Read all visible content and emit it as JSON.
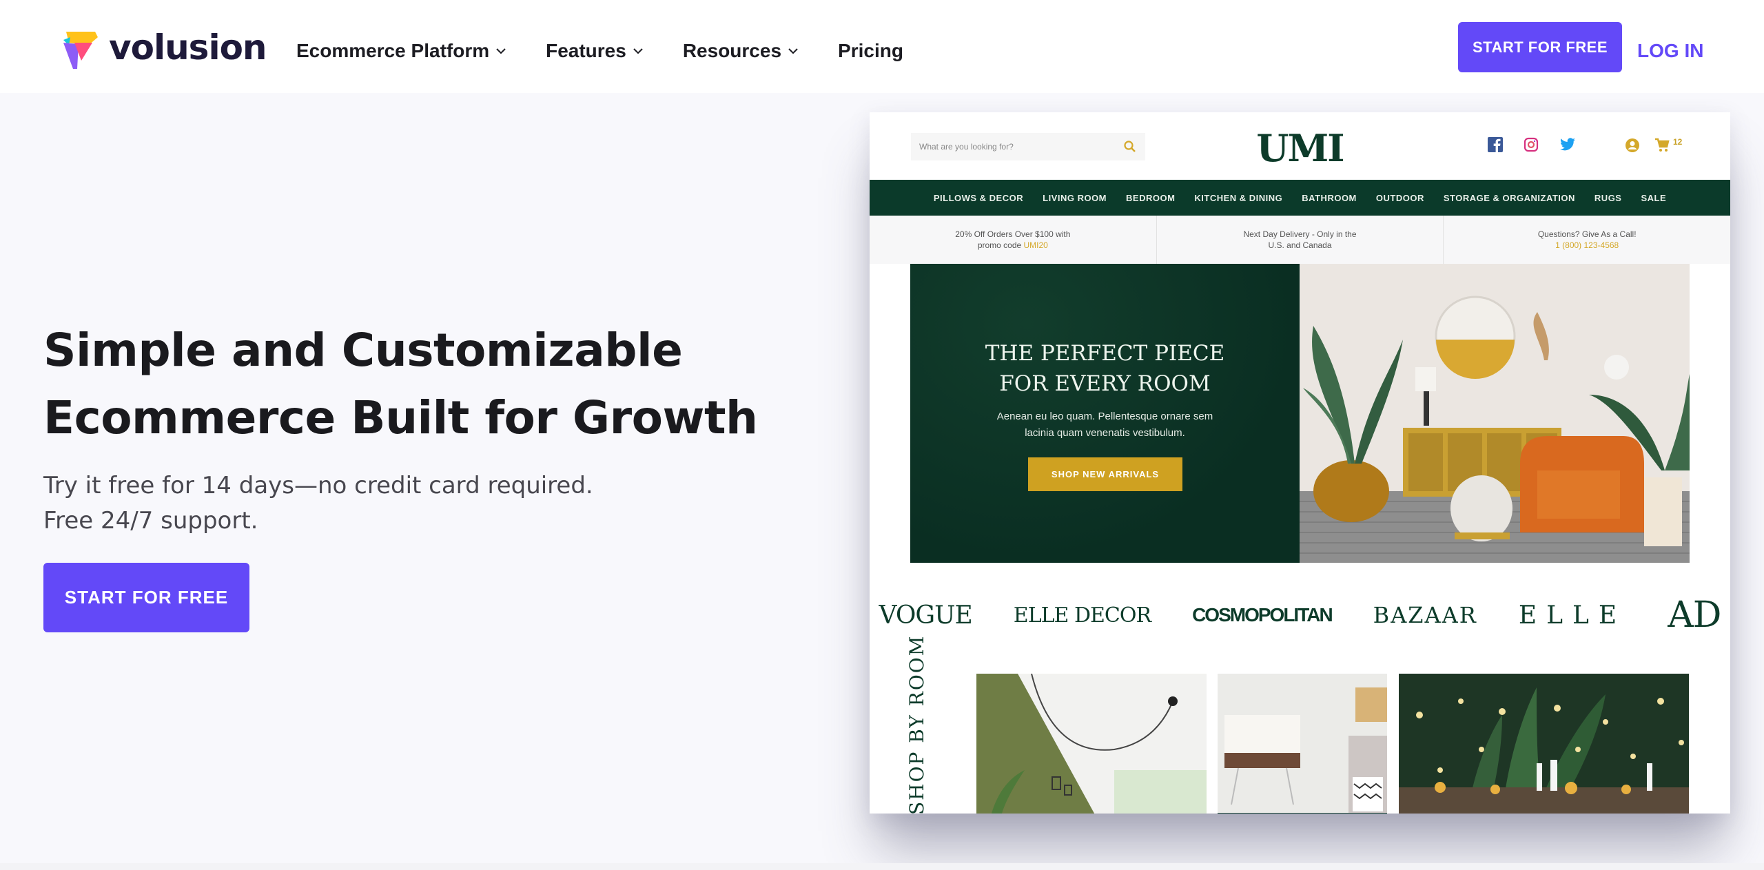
{
  "header": {
    "brand": "volusion",
    "nav": [
      {
        "label": "Ecommerce Platform",
        "has_dropdown": true
      },
      {
        "label": "Features",
        "has_dropdown": true
      },
      {
        "label": "Resources",
        "has_dropdown": true
      },
      {
        "label": "Pricing",
        "has_dropdown": false
      }
    ],
    "start_label": "START FOR FREE",
    "login_label": "LOG IN",
    "accent_color": "#6349f8"
  },
  "hero": {
    "title_line1": "Simple and Customizable",
    "title_line2": "Ecommerce Built for Growth",
    "sub_line1": "Try it free for 14 days—no credit card required.",
    "sub_line2": "Free 24/7 support.",
    "cta_label": "START FOR FREE"
  },
  "preview": {
    "search_placeholder": "What are you looking for?",
    "store_logo": "UMI",
    "social_icons": [
      "facebook-icon",
      "instagram-icon",
      "twitter-icon"
    ],
    "cart_count": "12",
    "nav": [
      "PILLOWS & DECOR",
      "LIVING ROOM",
      "BEDROOM",
      "KITCHEN & DINING",
      "BATHROOM",
      "OUTDOOR",
      "STORAGE & ORGANIZATION",
      "RUGS",
      "SALE"
    ],
    "promos": [
      {
        "line1": "20% Off Orders Over $100 with",
        "line2_prefix": "promo code ",
        "line2_highlight": "UMI20"
      },
      {
        "line1": "Next Day Delivery - Only in the",
        "line2_prefix": "U.S. and Canada",
        "line2_highlight": ""
      },
      {
        "line1": "Questions? Give As a Call!",
        "line2_prefix": "",
        "line2_highlight": "1 (800) 123-4568"
      }
    ],
    "banner": {
      "title_line1": "THE PERFECT PIECE",
      "title_line2": "FOR EVERY ROOM",
      "text_line1": "Aenean eu leo quam. Pellentesque ornare sem",
      "text_line2": "lacinia quam venenatis vestibulum.",
      "button": "SHOP NEW ARRIVALS"
    },
    "press": [
      "VOGUE",
      "ELLE DECOR",
      "COSMOPOLITAN",
      "BAZAAR",
      "ELLE",
      "AD"
    ],
    "shop_by_room": "SHOP BY ROOM",
    "colors": {
      "green": "#0b3a2a",
      "gold": "#cfa121"
    }
  }
}
